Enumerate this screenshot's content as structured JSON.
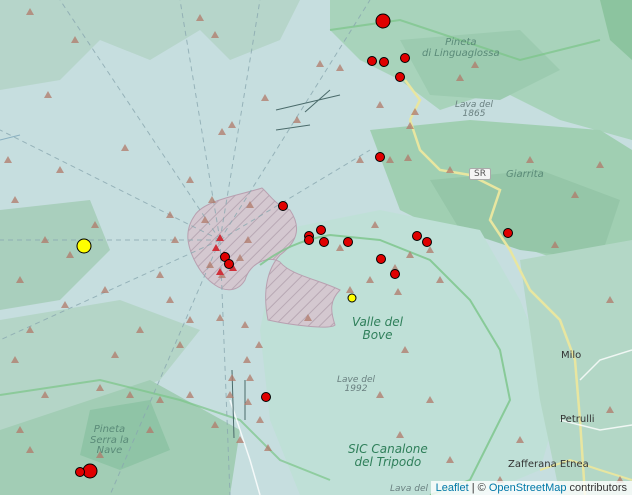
{
  "labels": {
    "pineta_linguaglossa": "Pineta\ndi Linguaglossa",
    "lava_1865": "Lava del\n1865",
    "sr": "SR",
    "giarrita": "Giarrita",
    "valle_del_bove": "Valle del\nBove",
    "lave_1992": "Lave del\n1992",
    "milo": "Milo",
    "petrulli": "Petrulli",
    "pineta_serra_nave": "Pineta\nSerra la\nNave",
    "sic_canalone": "SIC Canalone\ndel Tripodo",
    "zafferana": "Zafferana Etnea",
    "lava_bottom": "Lava del"
  },
  "attribution": {
    "leaflet": "Leaflet",
    "separator": " | © ",
    "osm": "OpenStreetMap",
    "contributors": " contributors"
  },
  "colors": {
    "red_marker": "#e00000",
    "yellow_marker": "#ffff00",
    "triangle": "#b07a6a",
    "summit_triangle": "#d0303a"
  },
  "markers": {
    "red": [
      {
        "size": "large"
      },
      {
        "size": "small"
      },
      {
        "size": "small"
      },
      {
        "size": "small"
      },
      {
        "size": "small"
      },
      {
        "size": "small"
      },
      {
        "size": "small"
      },
      {
        "size": "small"
      },
      {
        "size": "small"
      },
      {
        "size": "small"
      },
      {
        "size": "small"
      },
      {
        "size": "small"
      },
      {
        "size": "small"
      },
      {
        "size": "small"
      },
      {
        "size": "small"
      },
      {
        "size": "small"
      },
      {
        "size": "small"
      },
      {
        "size": "small"
      },
      {
        "size": "small"
      },
      {
        "size": "small"
      },
      {
        "size": "large"
      },
      {
        "size": "small"
      }
    ],
    "yellow": [
      {
        "size": "large"
      },
      {
        "size": "small"
      }
    ]
  }
}
